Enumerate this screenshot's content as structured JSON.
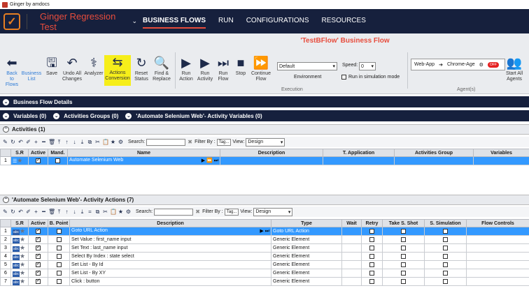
{
  "window": {
    "title": "Ginger by amdocs"
  },
  "nav": {
    "solution": "Ginger Regression Test",
    "tabs": [
      "BUSINESS FLOWS",
      "RUN",
      "CONFIGURATIONS",
      "RESOURCES"
    ]
  },
  "bf_title": "'TestBFlow' Business Flow",
  "ribbon": {
    "buttons": [
      {
        "label": "Back to Flows",
        "icon": "arrow-left-icon"
      },
      {
        "label": "Business List",
        "icon": "list-icon"
      },
      {
        "label": "Save",
        "icon": "save-icon"
      },
      {
        "label": "Undo All Changes",
        "icon": "undo-icon"
      },
      {
        "label": "Analyzer",
        "icon": "stethoscope-icon"
      },
      {
        "label": "Actions Conversion",
        "icon": "conversion-icon"
      },
      {
        "label": "Reset Status",
        "icon": "reset-icon"
      },
      {
        "label": "Find & Replace",
        "icon": "search-icon"
      },
      {
        "label": "Run Action",
        "icon": "run-action-icon"
      },
      {
        "label": "Run Activity",
        "icon": "run-activity-icon"
      },
      {
        "label": "Run Flow",
        "icon": "run-flow-icon"
      },
      {
        "label": "Stop",
        "icon": "stop-icon"
      },
      {
        "label": "Continue Flow",
        "icon": "continue-icon"
      }
    ],
    "environment_value": "Default",
    "environment_label": "Environment",
    "speed_label": "Speed:",
    "speed_value": "0",
    "simulation_label": "Run in simulation mode",
    "execution_label": "Execution",
    "agent_app": "Web-App",
    "agent_name": "Chrome-Age",
    "agent_toggle": "OFF",
    "agents_label": "Agent(s)",
    "start_agents": "Start All Agents"
  },
  "sections": {
    "details": "Business Flow Details",
    "variables": "Variables (0)",
    "activity_groups": "Activities Groups (0)",
    "activity_vars": "'Automate Selenium Web'- Activity Variables (0)",
    "activities": "Activities (1)",
    "actions": "'Automate Selenium Web'- Activity Actions (7)"
  },
  "toolbar": {
    "search_label": "Search:",
    "filter_label": "Filter By :",
    "tag_btn": "Tag...",
    "view_label": "View:",
    "view_value": "Design"
  },
  "activities_grid": {
    "headers": [
      "S.R",
      "Active",
      "Mand.",
      "Name",
      "Description",
      "T. Application",
      "Activities Group",
      "Variables"
    ],
    "rows": [
      {
        "num": "1",
        "name": "Automate Selenium Web"
      }
    ]
  },
  "actions_grid": {
    "headers": [
      "S.R",
      "Active",
      "B. Point",
      "Description",
      "Type",
      "Wait",
      "Retry",
      "Take S. Shot",
      "S. Simulation",
      "Flow Controls"
    ],
    "rows": [
      {
        "num": "1",
        "desc": "Goto URL Action",
        "type": "Goto URL Action"
      },
      {
        "num": "2",
        "desc": "Set Value : first_name input",
        "type": "Generic Element"
      },
      {
        "num": "3",
        "desc": "Set Text : last_name input",
        "type": "Generic Element"
      },
      {
        "num": "4",
        "desc": "Select By Index : state select",
        "type": "Generic Element"
      },
      {
        "num": "5",
        "desc": "Set List - By Id",
        "type": "Generic Element"
      },
      {
        "num": "6",
        "desc": "Set List - By XY",
        "type": "Generic Element"
      },
      {
        "num": "7",
        "desc": "Click : button",
        "type": "Generic Element"
      }
    ]
  },
  "colors": {
    "nav": "#16203d",
    "accent": "#e74c3c",
    "highlight": "#f6ee1a",
    "select": "#3399ff"
  }
}
